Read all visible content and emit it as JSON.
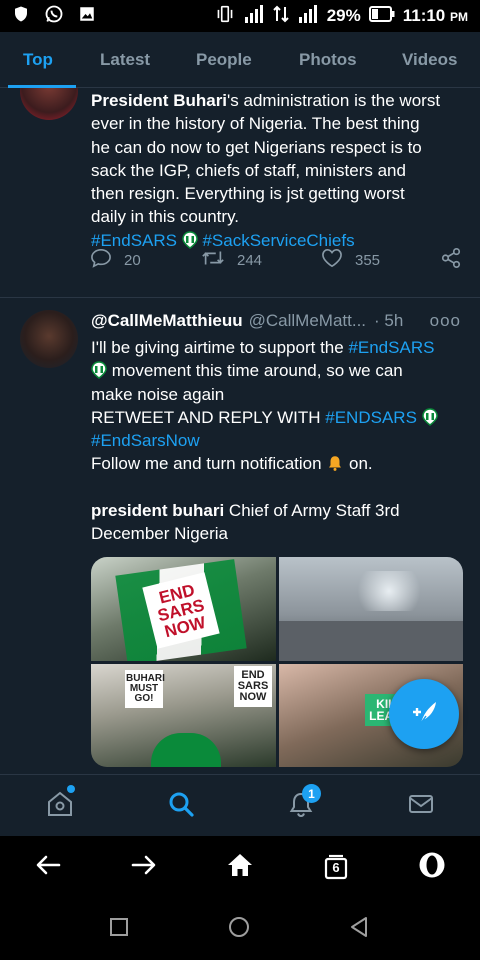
{
  "status_bar": {
    "battery": "29%",
    "time": "11:10",
    "ampm": "PM"
  },
  "tabs": [
    {
      "label": "Top",
      "active": true
    },
    {
      "label": "Latest",
      "active": false
    },
    {
      "label": "People",
      "active": false
    },
    {
      "label": "Photos",
      "active": false
    },
    {
      "label": "Videos",
      "active": false
    }
  ],
  "tweet1": {
    "line1_name": "President Buhari",
    "line1_rest": "'s administration is the worst",
    "line2": "ever in the history of Nigeria. The best thing",
    "line3": "he can do now to get Nigerians respect is to",
    "line4": "sack the IGP, chiefs of staff, ministers and",
    "line5": "then resign. Everything is jst getting worst",
    "line6": "daily in this country.",
    "hashtag1": "#EndSARS",
    "hashtag2": "#SackServiceChiefs",
    "replies": "20",
    "retweets": "244",
    "likes": "355"
  },
  "tweet2": {
    "name": "@CallMeMatthieuu",
    "handle": "@CallMeMatt...",
    "time": "· 5h",
    "more": "ooo",
    "l1_a": "I'll be giving airtime to support the ",
    "l1_hash": "#EndSARS",
    "l2": " movement this time around, so we can",
    "l3": "make noise again",
    "l4_a": "RETWEET AND REPLY WITH ",
    "l4_hash": "#ENDSARS",
    "l5_hash": "#EndSarsNow",
    "l6_a": "Follow me and turn notification ",
    "l6_b": " on.",
    "l7_bold": "president buhari",
    "l7_rest": " Chief of Army Staff 3rd",
    "l8": "December Nigeria",
    "media_signs": {
      "m1": "END SARS NOW",
      "m3_left": "BUHARI MUST GO!",
      "m3_right": "END SARS NOW",
      "m4": "KILL LEADE"
    }
  },
  "bottom_nav": {
    "notifications_badge": "1"
  },
  "browser": {
    "tab_count": "6"
  },
  "colors": {
    "accent": "#1da1f2",
    "background": "#15202b",
    "muted": "#8899a6"
  }
}
